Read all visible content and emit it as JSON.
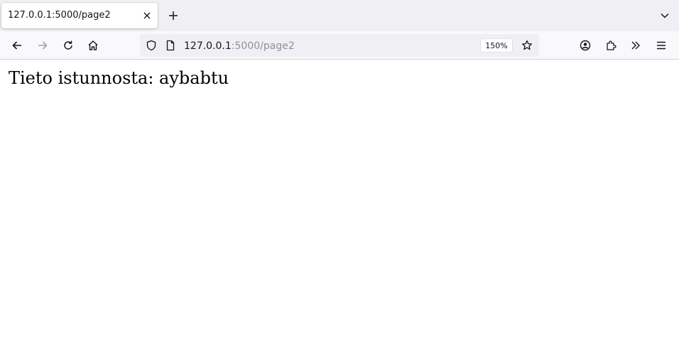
{
  "tab": {
    "title": "127.0.0.1:5000/page2"
  },
  "toolbar": {
    "url_host": "127.0.0.1",
    "url_path": ":5000/page2",
    "zoom_level": "150%"
  },
  "page": {
    "session_text": "Tieto istunnosta: aybabtu"
  },
  "icons": {
    "tab_close": "close-icon",
    "new_tab": "plus-icon",
    "tab_list": "chevron-down-icon",
    "back": "arrow-left-icon",
    "forward": "arrow-right-icon",
    "reload": "reload-icon",
    "home": "home-icon",
    "tracking": "shield-icon",
    "page_info": "page-icon",
    "bookmark": "star-icon",
    "account": "account-icon",
    "extensions": "puzzle-icon",
    "overflow": "double-chevron-icon",
    "menu": "hamburger-icon"
  },
  "colors": {
    "tabbar_bg": "#f0f0f4",
    "toolbar_bg": "#f9f9fb",
    "urlbar_bg": "#f0f0f4",
    "text": "#15141a",
    "url_path_gray": "#8f8f9d",
    "forward_disabled": "#a0a0a8"
  }
}
